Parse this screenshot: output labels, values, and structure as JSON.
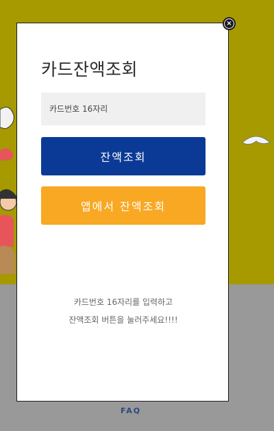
{
  "modal": {
    "title": "카드잔액조회",
    "card_input": {
      "placeholder": "카드번호 16자리",
      "value": ""
    },
    "balance_button_label": "잔액조회",
    "app_balance_button_label": "앱에서 잔액조회",
    "help_line_1": "카드번호 16자리를 입력하고",
    "help_line_2": "잔액조회 버튼을 눌러주세요!!!!",
    "close_icon": "close-icon"
  },
  "footer": {
    "faq_label": "FAQ"
  },
  "colors": {
    "background_top": "#a69a00",
    "background_bottom": "#999999",
    "balance_button": "#0b3a96",
    "app_button": "#f8a823",
    "input_bg": "#f0f0f0"
  }
}
